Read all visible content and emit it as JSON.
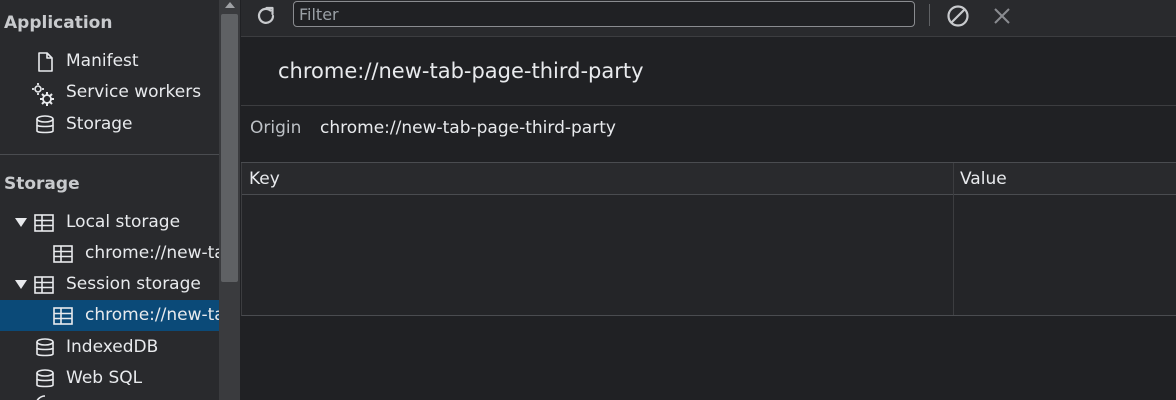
{
  "sidebar": {
    "application_header": "Application",
    "storage_header": "Storage",
    "app_items": [
      {
        "label": "Manifest",
        "icon": "document-icon"
      },
      {
        "label": "Service workers",
        "icon": "gears-icon"
      },
      {
        "label": "Storage",
        "icon": "database-icon"
      }
    ],
    "local_storage": {
      "label": "Local storage",
      "child": "chrome://new-tab-page-third-party"
    },
    "session_storage": {
      "label": "Session storage",
      "child": "chrome://new-tab-page-third-party"
    },
    "indexeddb": "IndexedDB",
    "websql": "Web SQL"
  },
  "toolbar": {
    "filter_placeholder": "Filter",
    "filter_value": ""
  },
  "main": {
    "title": "chrome://new-tab-page-third-party",
    "origin_label": "Origin",
    "origin_value": "chrome://new-tab-page-third-party",
    "columns": [
      "Key",
      "Value"
    ],
    "rows": []
  },
  "colors": {
    "selected_bg": "#0b4a78",
    "panel_bg": "#202124",
    "sidebar_bg": "#292a2d"
  }
}
